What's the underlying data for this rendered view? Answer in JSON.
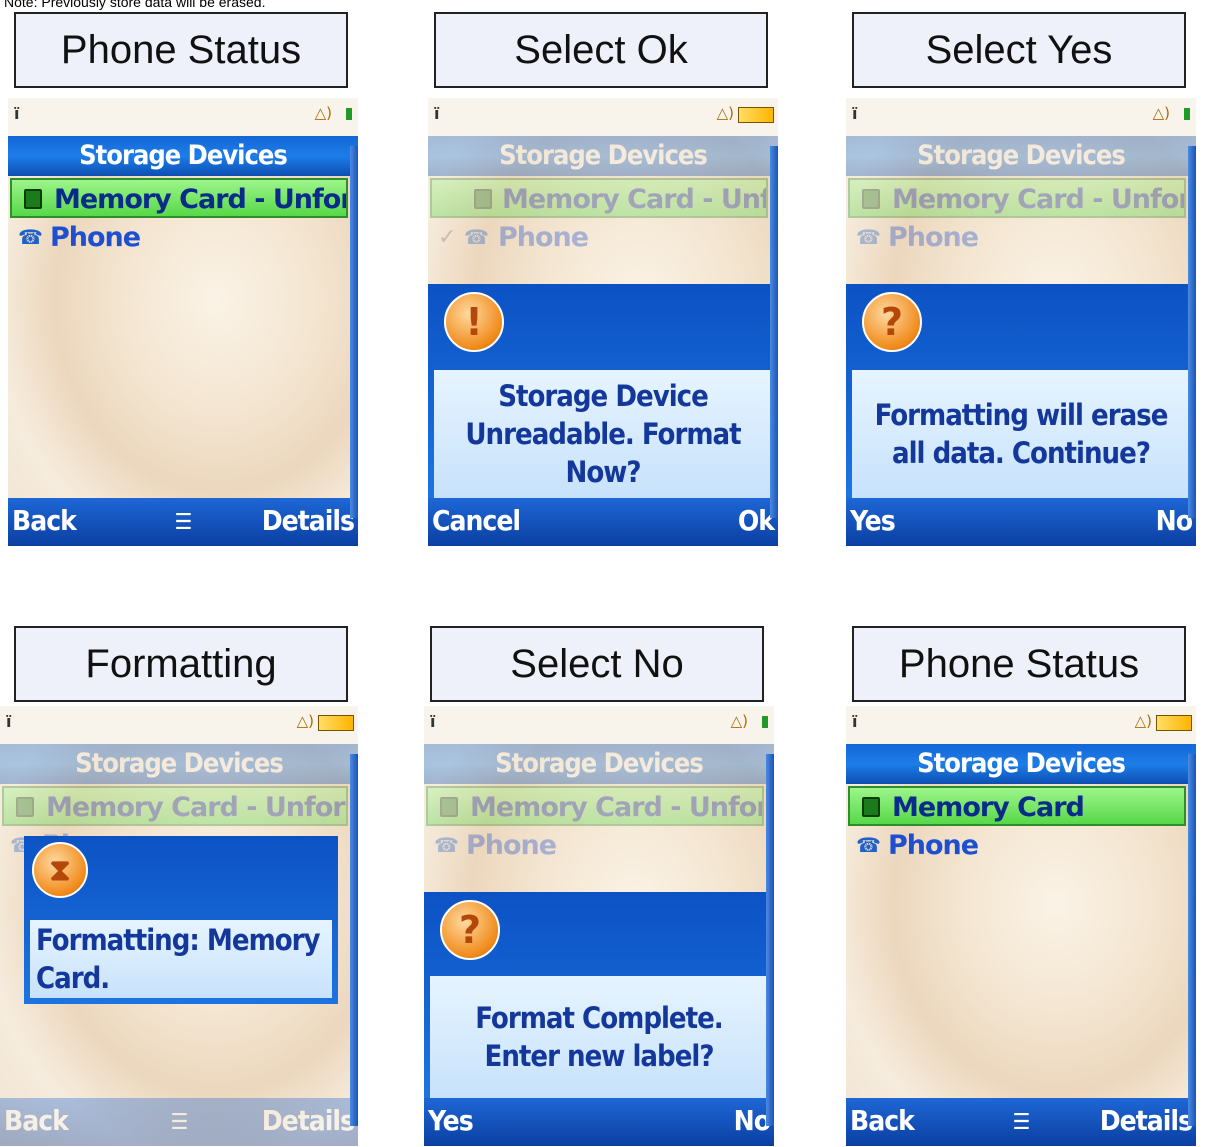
{
  "note": "Note: Previously store data will be erased.",
  "panels": [
    {
      "caption": "Phone Status",
      "title": "Storage Devices",
      "items": [
        "Memory Card - Unforma...",
        "Phone"
      ],
      "soft_left": "Back",
      "soft_center": "☰",
      "soft_right": "Details"
    },
    {
      "caption": "Select Ok",
      "title": "Storage Devices",
      "items": [
        "Memory Card - Unfor...",
        "Phone"
      ],
      "check": "✓",
      "message": "Storage Device Unreadable. Format Now?",
      "dialog_icon": "!",
      "soft_left": "Cancel",
      "soft_right": "Ok"
    },
    {
      "caption": "Select Yes",
      "title": "Storage Devices",
      "items": [
        "Memory Card - Unforma...",
        "Phone"
      ],
      "message": "Formatting will erase all data. Continue?",
      "dialog_icon": "?",
      "soft_left": "Yes",
      "soft_right": "No"
    },
    {
      "caption": "Formatting",
      "title": "Storage Devices",
      "items": [
        "Memory Card - Unforma...",
        "Phone"
      ],
      "message": "Formatting: Memory Card.",
      "dialog_icon": "⧗",
      "soft_left": "Back",
      "soft_center": "☰",
      "soft_right": "Details"
    },
    {
      "caption": "Select No",
      "title": "Storage Devices",
      "items": [
        "Memory Card - Unforma...",
        "Phone"
      ],
      "message": "Format Complete. Enter new label?",
      "dialog_icon": "?",
      "soft_left": "Yes",
      "soft_right": "No"
    },
    {
      "caption": "Phone Status",
      "title": "Storage Devices",
      "items": [
        "Memory Card",
        "Phone"
      ],
      "soft_left": "Back",
      "soft_center": "☰",
      "soft_right": "Details"
    }
  ],
  "status": {
    "signal_icon": "signal-icon",
    "alarm_glyph": "🔔)",
    "battery_icon": "battery-icon"
  }
}
